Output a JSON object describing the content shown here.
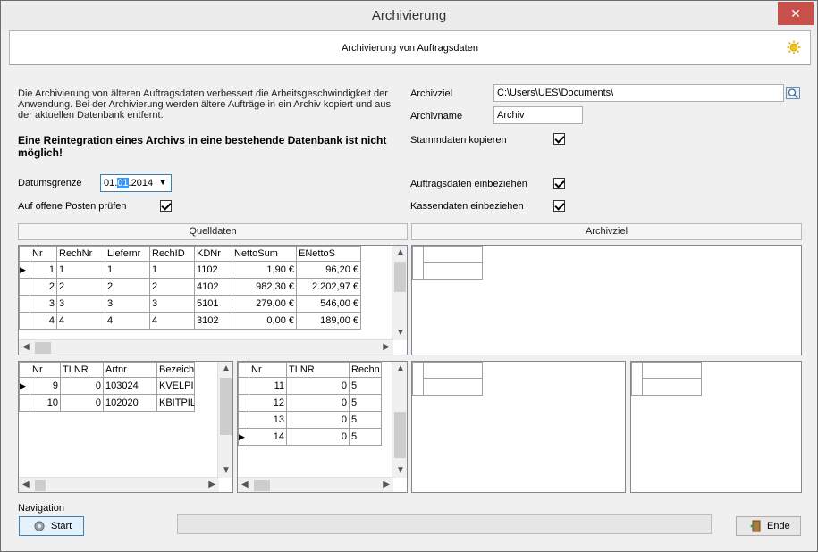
{
  "window": {
    "title": "Archivierung",
    "close_glyph": "✕"
  },
  "header": {
    "title": "Archivierung von Auftragsdaten",
    "icon": "sun-icon"
  },
  "description": "Die Archivierung von älteren Auftragsdaten verbessert die Arbeitsgeschwindigkeit der Anwendung. Bei der Archivierung werden ältere Aufträge in ein Archiv kopiert und aus der aktuellen Datenbank entfernt.",
  "warning": "Eine Reintegration eines Archivs in eine bestehende Datenbank ist nicht möglich!",
  "date": {
    "label": "Datumsgrenze",
    "day": "01.",
    "month": "01",
    "year": ".2014"
  },
  "open_items": {
    "label": "Auf offene Posten prüfen",
    "checked": true
  },
  "archive": {
    "target_label": "Archivziel",
    "target_value": "C:\\Users\\UES\\Documents\\",
    "name_label": "Archivname",
    "name_value": "Archiv",
    "master_label": "Stammdaten kopieren",
    "master_checked": true,
    "orders_label": "Auftragsdaten einbeziehen",
    "orders_checked": true,
    "cash_label": "Kassendaten einbeziehen",
    "cash_checked": true
  },
  "sections": {
    "source": "Quelldaten",
    "target": "Archivziel"
  },
  "grid_main": {
    "columns": [
      "Nr",
      "RechNr",
      "Liefernr",
      "RechID",
      "KDNr",
      "NettoSum",
      "ENettoS"
    ],
    "rows": [
      [
        "1",
        "1",
        "1",
        "1",
        "1102",
        "1,90 €",
        "96,20 €"
      ],
      [
        "2",
        "2",
        "2",
        "2",
        "4102",
        "982,30 €",
        "2.202,97 €"
      ],
      [
        "3",
        "3",
        "3",
        "3",
        "5101",
        "279,00 €",
        "546,00 €"
      ],
      [
        "4",
        "4",
        "4",
        "4",
        "3102",
        "0,00 €",
        "189,00 €"
      ]
    ]
  },
  "grid_items": {
    "columns": [
      "Nr",
      "TLNR",
      "Artnr",
      "Bezeichn"
    ],
    "rows": [
      [
        "9",
        "0",
        "103024",
        "KVELPIL"
      ],
      [
        "10",
        "0",
        "102020",
        "KBITPIL"
      ]
    ]
  },
  "grid_sub": {
    "columns": [
      "Nr",
      "TLNR",
      "Rechn"
    ],
    "rows": [
      [
        "11",
        "0",
        "5"
      ],
      [
        "12",
        "0",
        "5"
      ],
      [
        "13",
        "0",
        "5"
      ],
      [
        "14",
        "0",
        "5"
      ]
    ]
  },
  "navigation": {
    "label": "Navigation",
    "start": "Start",
    "end": "Ende"
  }
}
